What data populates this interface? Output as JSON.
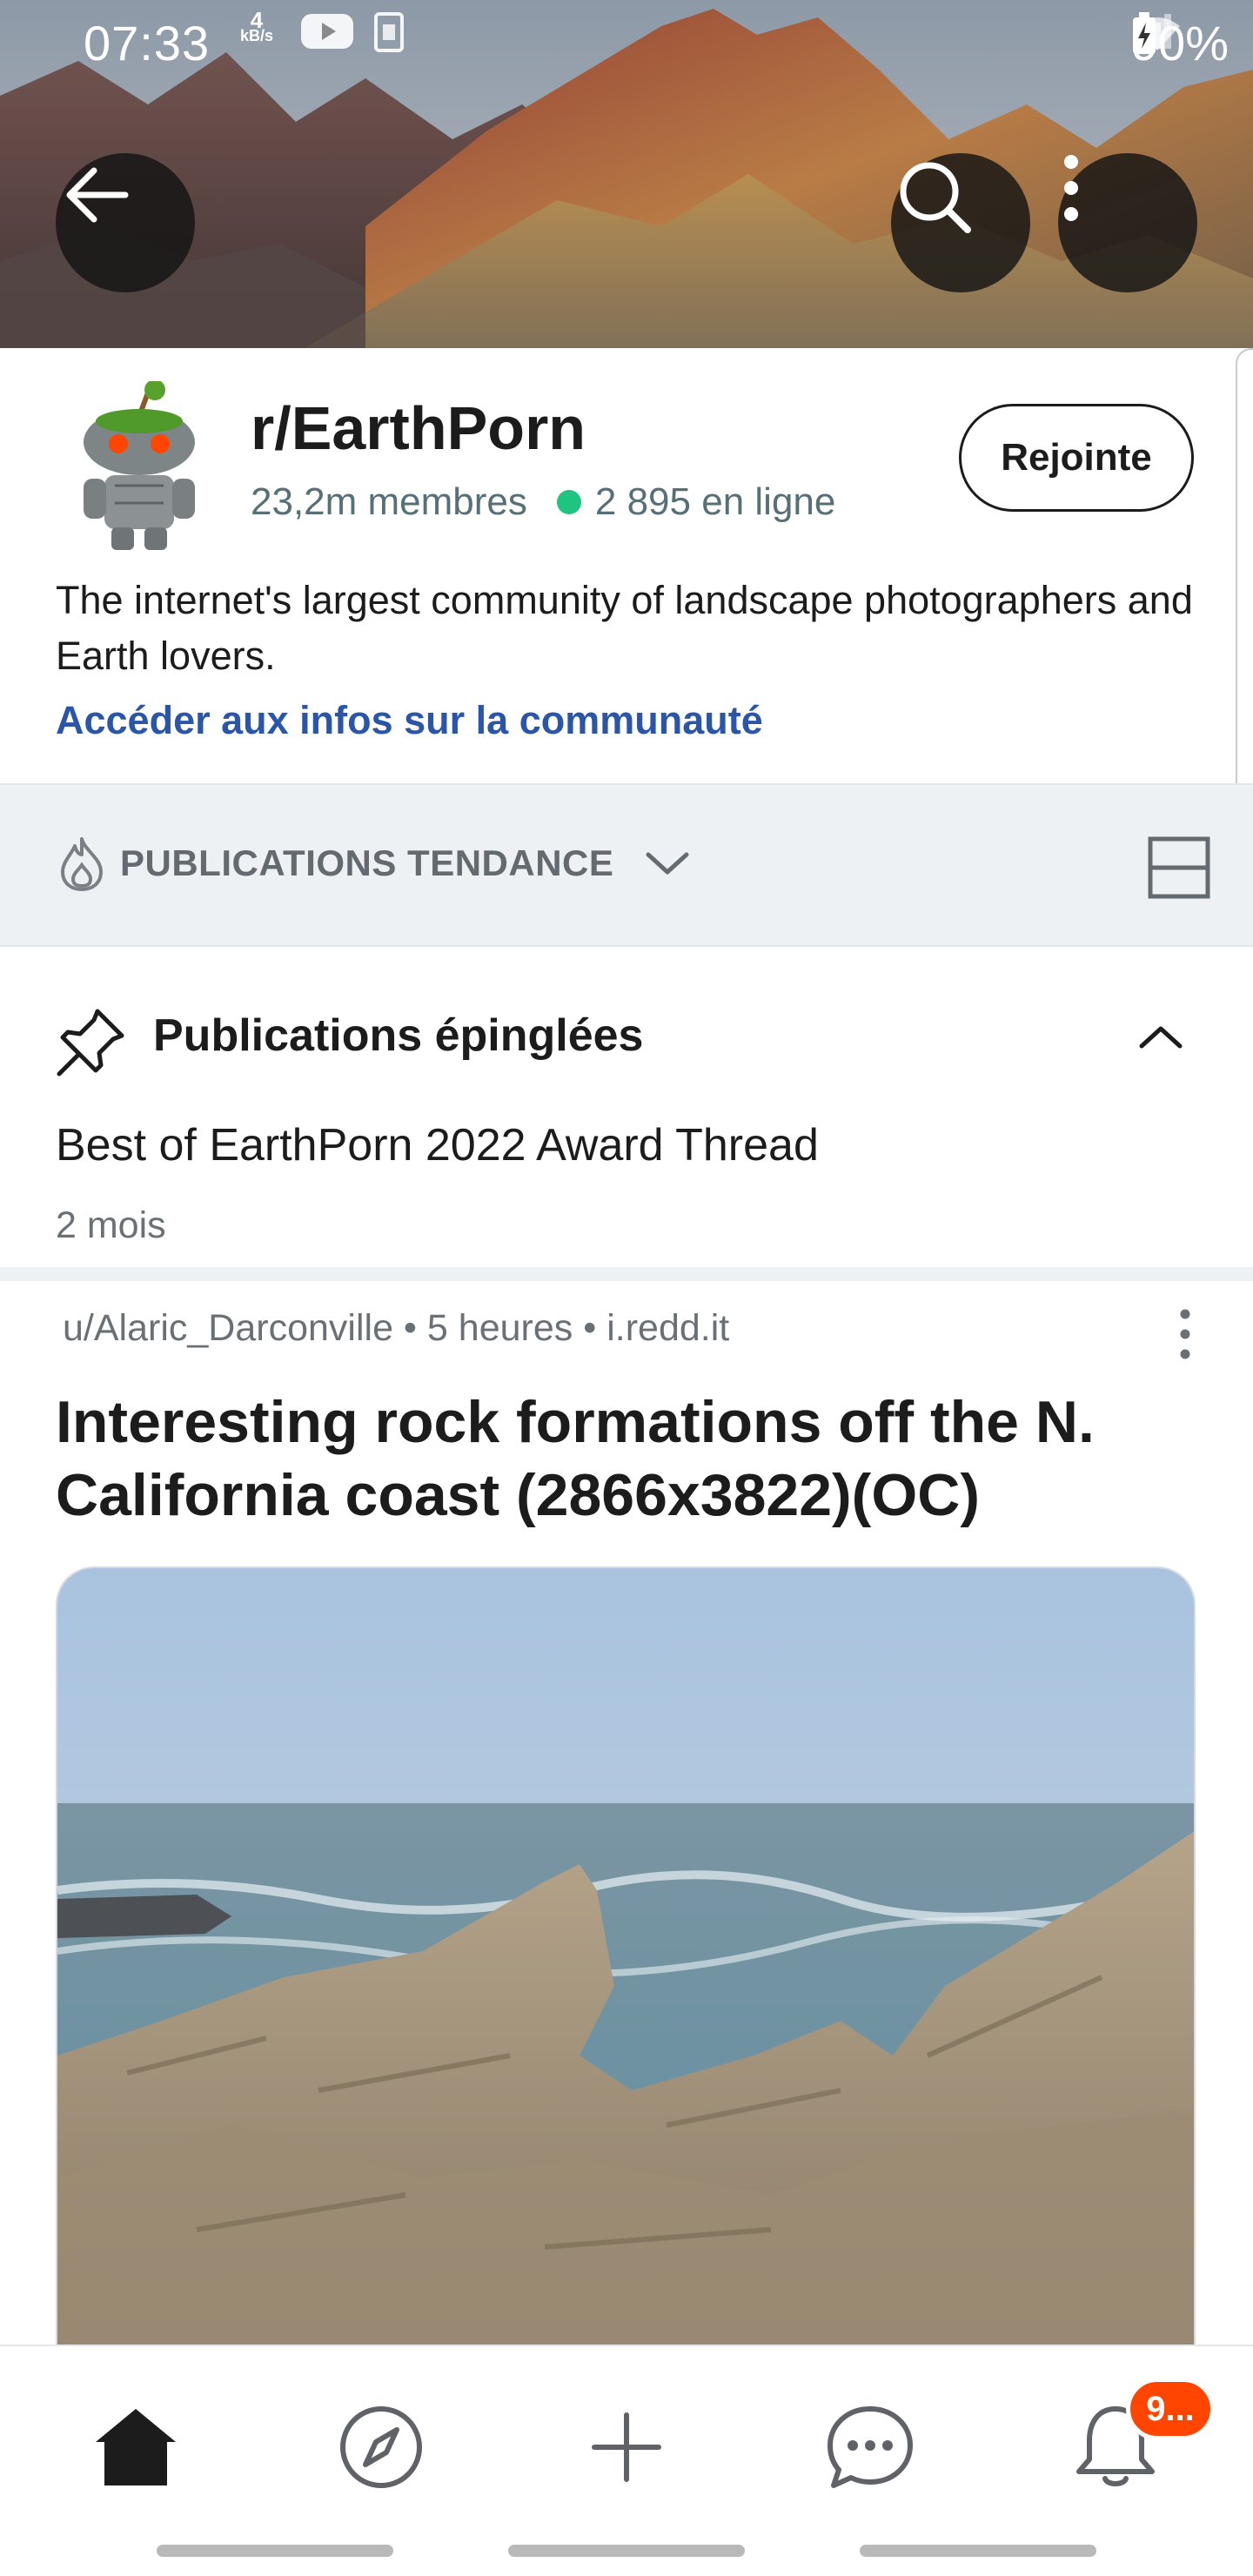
{
  "status_bar": {
    "time": "07:33",
    "speed_value": "4",
    "speed_unit": "kB/s",
    "battery": "90%"
  },
  "banner": {
    "back_icon": "arrow-left-icon",
    "search_icon": "search-icon",
    "more_icon": "more-vertical-icon"
  },
  "community": {
    "name": "r/EarthPorn",
    "members": "23,2m membres",
    "online": "2 895 en ligne",
    "join_label": "Rejointe",
    "description": "The internet's largest community of landscape photographers and Earth lovers.",
    "info_link": "Accéder aux infos sur la communauté"
  },
  "sort": {
    "label": "PUBLICATIONS TENDANCE",
    "icon": "flame-icon",
    "layout_icon": "card-layout-icon"
  },
  "pinned": {
    "title": "Publications épinglées",
    "post_title": "Best of EarthPorn 2022 Award Thread",
    "post_time": "2 mois"
  },
  "post": {
    "meta": "u/Alaric_Darconville • 5 heures • i.redd.it",
    "title": "Interesting rock formations off the N. California coast (2866x3822)(OC)"
  },
  "bottom_nav": {
    "items": [
      "home-icon",
      "explore-icon",
      "create-icon",
      "chat-icon",
      "notifications-icon"
    ],
    "badge": "9..."
  },
  "colors": {
    "accent_orange": "#ff4500",
    "link_blue": "#2a55a8",
    "online_green": "#1fc480"
  }
}
